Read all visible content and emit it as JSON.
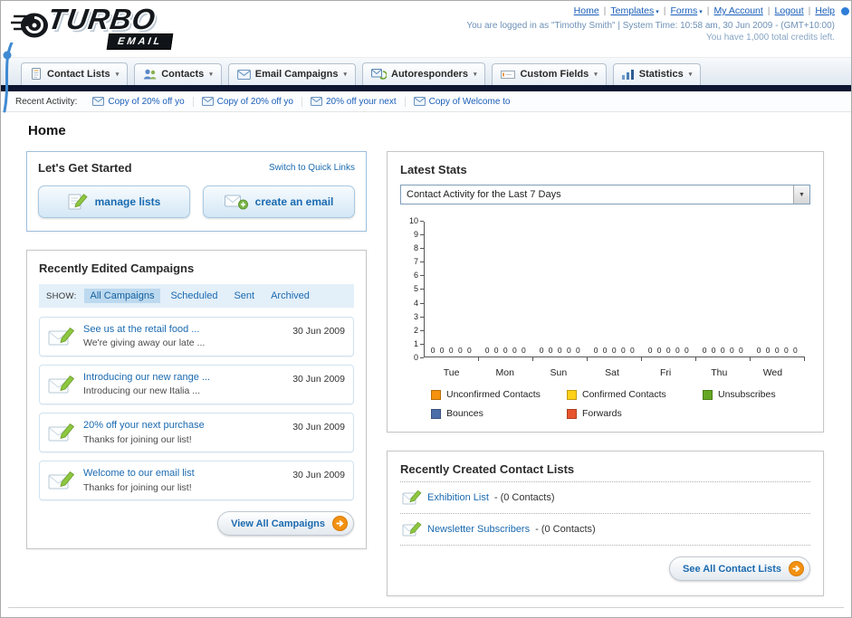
{
  "header": {
    "logo_text": "TURBO",
    "logo_sub": "EMAIL",
    "nav_links": [
      {
        "label": "Home"
      },
      {
        "label": "Templates",
        "arrow": true
      },
      {
        "label": "Forms",
        "arrow": true
      },
      {
        "label": "My Account"
      },
      {
        "label": "Logout"
      },
      {
        "label": "Help"
      }
    ],
    "login_info": "You are logged in as \"Timothy Smith\" | System Time: 10:58 am, 30 Jun 2009 - (GMT+10:00)",
    "credits_info": "You have 1,000 total credits left."
  },
  "nav_tabs": [
    {
      "id": "contact-lists",
      "label": "Contact Lists",
      "icon": "contact-lists"
    },
    {
      "id": "contacts",
      "label": "Contacts",
      "icon": "contacts"
    },
    {
      "id": "email-campaigns",
      "label": "Email Campaigns",
      "icon": "email-campaigns"
    },
    {
      "id": "autoresponders",
      "label": "Autoresponders",
      "icon": "autoresponders"
    },
    {
      "id": "custom-fields",
      "label": "Custom Fields",
      "icon": "custom-fields"
    },
    {
      "id": "statistics",
      "label": "Statistics",
      "icon": "statistics"
    }
  ],
  "recent_activity": {
    "label": "Recent Activity:",
    "items": [
      "Copy of 20% off yo",
      "Copy of 20% off yo",
      "20% off your next",
      "Copy of Welcome to"
    ]
  },
  "page_title": "Home",
  "get_started": {
    "title": "Let's Get Started",
    "switch_link": "Switch to Quick Links",
    "buttons": [
      {
        "label": "manage lists",
        "icon": "pencil-page-icon"
      },
      {
        "label": "create an email",
        "icon": "envelope-plus-icon"
      }
    ]
  },
  "campaigns": {
    "title": "Recently Edited Campaigns",
    "show_label": "SHOW:",
    "filters": [
      "All Campaigns",
      "Scheduled",
      "Sent",
      "Archived"
    ],
    "active_filter": "All Campaigns",
    "items": [
      {
        "title": "See us at the retail food ...",
        "subtitle": "We're giving away our late ...",
        "date": "30 Jun 2009"
      },
      {
        "title": "Introducing our new range ...",
        "subtitle": "Introducing our new Italia ...",
        "date": "30 Jun 2009"
      },
      {
        "title": "20% off your next purchase",
        "subtitle": "Thanks for joining our list!",
        "date": "30 Jun 2009"
      },
      {
        "title": "Welcome to our email list",
        "subtitle": "Thanks for joining our list!",
        "date": "30 Jun 2009"
      }
    ],
    "view_all_label": "View All Campaigns"
  },
  "stats": {
    "title": "Latest Stats",
    "dropdown_value": "Contact Activity for the Last 7 Days",
    "legend": [
      {
        "label": "Unconfirmed Contacts",
        "color": "#f5920f"
      },
      {
        "label": "Confirmed Contacts",
        "color": "#ffd11a"
      },
      {
        "label": "Unsubscribes",
        "color": "#64a722"
      },
      {
        "label": "Bounces",
        "color": "#4d6da8"
      },
      {
        "label": "Forwards",
        "color": "#e8542e"
      }
    ]
  },
  "chart_data": {
    "type": "bar",
    "title": "Contact Activity for the Last 7 Days",
    "categories": [
      "Tue",
      "Mon",
      "Sun",
      "Sat",
      "Fri",
      "Thu",
      "Wed"
    ],
    "series": [
      {
        "name": "Unconfirmed Contacts",
        "color": "#f5920f",
        "values": [
          0,
          0,
          0,
          0,
          0,
          0,
          0
        ]
      },
      {
        "name": "Confirmed Contacts",
        "color": "#ffd11a",
        "values": [
          0,
          0,
          0,
          0,
          0,
          0,
          0
        ]
      },
      {
        "name": "Unsubscribes",
        "color": "#64a722",
        "values": [
          0,
          0,
          0,
          0,
          0,
          0,
          0
        ]
      },
      {
        "name": "Bounces",
        "color": "#4d6da8",
        "values": [
          0,
          0,
          0,
          0,
          0,
          0,
          0
        ]
      },
      {
        "name": "Forwards",
        "color": "#e8542e",
        "values": [
          0,
          0,
          0,
          0,
          0,
          0,
          0
        ]
      }
    ],
    "ylim": [
      0,
      10
    ],
    "xlabel": "",
    "ylabel": "",
    "grid": false,
    "legend_position": "bottom"
  },
  "contact_lists": {
    "title": "Recently Created Contact Lists",
    "items": [
      {
        "name": "Exhibition List",
        "suffix": " - (0 Contacts)"
      },
      {
        "name": "Newsletter Subscribers",
        "suffix": " - (0 Contacts)"
      }
    ],
    "see_all_label": "See All Contact Lists"
  }
}
